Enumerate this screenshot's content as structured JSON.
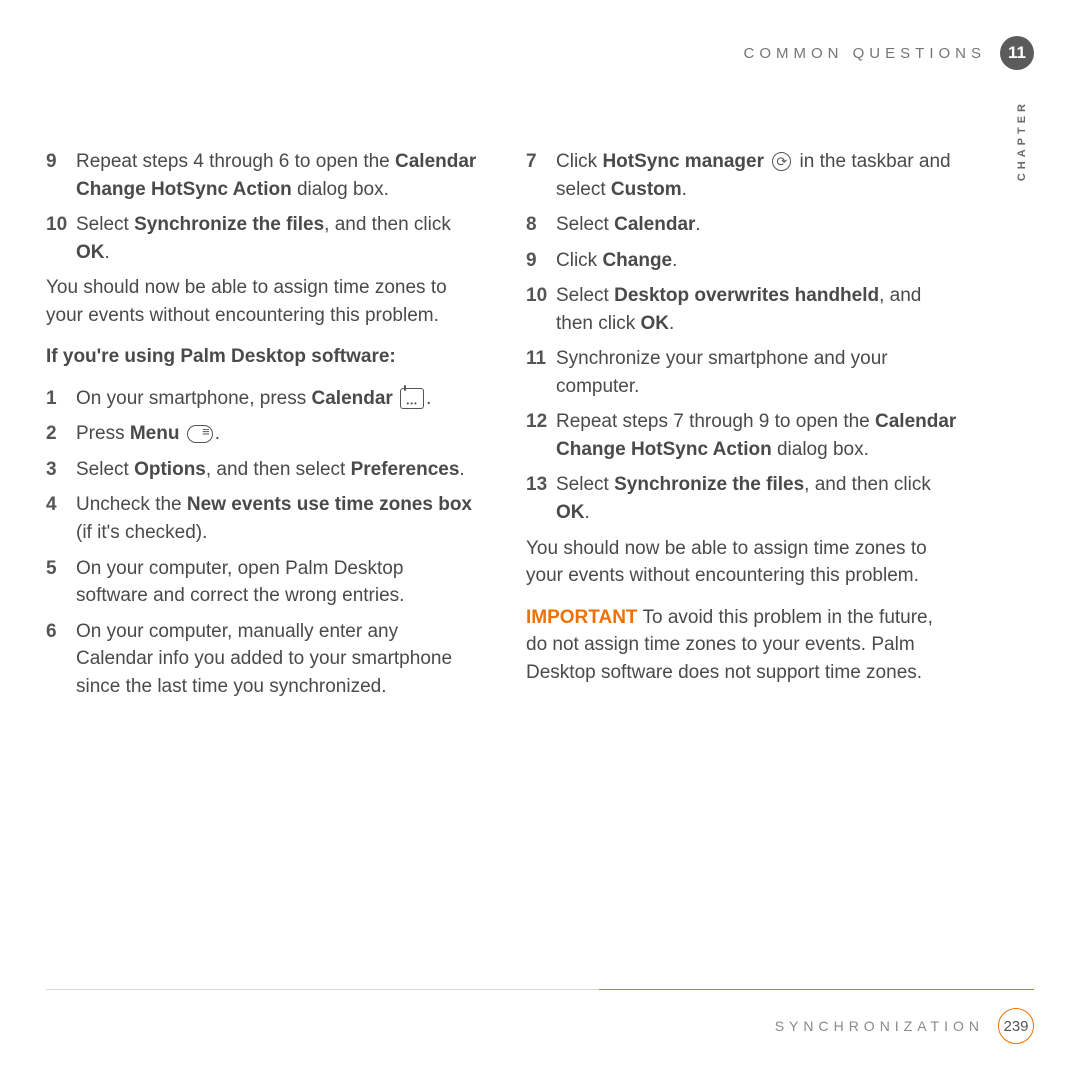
{
  "header": {
    "title": "COMMON QUESTIONS",
    "chapter_number": "11",
    "side_label": "CHAPTER"
  },
  "left": {
    "s9_a": "Repeat steps 4 through 6 to open the ",
    "s9_b": "Calendar Change HotSync Action",
    "s9_c": " dialog box.",
    "s10_a": "Select ",
    "s10_b": "Synchronize the files",
    "s10_c": ", and then click ",
    "s10_d": "OK",
    "s10_e": ".",
    "para1": "You should now be able to assign time zones to your events without encountering this problem.",
    "subhead": "If you're using Palm Desktop software:",
    "s1_a": "On your smartphone, press ",
    "s1_b": "Calendar",
    "s1_c": ".",
    "s2_a": "Press ",
    "s2_b": "Menu",
    "s2_c": ".",
    "s3_a": "Select ",
    "s3_b": "Options",
    "s3_c": ", and then select ",
    "s3_d": "Preferences",
    "s3_e": ".",
    "s4_a": "Uncheck the ",
    "s4_b": "New events use time zones box",
    "s4_c": " (if it's checked).",
    "s5": "On your computer, open Palm Desktop software and correct the wrong entries.",
    "s6": "On your computer, manually enter any Calendar info you added to your smartphone since the last time you synchronized."
  },
  "right": {
    "s7_a": "Click ",
    "s7_b": "HotSync manager",
    "s7_c": " in the taskbar and select ",
    "s7_d": "Custom",
    "s7_e": ".",
    "s8_a": "Select ",
    "s8_b": "Calendar",
    "s8_c": ".",
    "s9_a": "Click ",
    "s9_b": "Change",
    "s9_c": ".",
    "s10_a": "Select ",
    "s10_b": "Desktop overwrites handheld",
    "s10_c": ", and then click ",
    "s10_d": "OK",
    "s10_e": ".",
    "s11": "Synchronize your smartphone and your computer.",
    "s12_a": "Repeat steps 7 through 9 to open the ",
    "s12_b": "Calendar Change HotSync Action",
    "s12_c": " dialog box.",
    "s13_a": "Select ",
    "s13_b": "Synchronize the files",
    "s13_c": ", and then click ",
    "s13_d": "OK",
    "s13_e": ".",
    "para2": "You should now be able to assign time zones to your events without encountering this problem.",
    "imp_label": "IMPORTANT",
    "imp_text": " To avoid this problem in the future, do not assign time zones to your events. Palm Desktop software does not support time zones."
  },
  "nums": {
    "n1": "1",
    "n2": "2",
    "n3": "3",
    "n4": "4",
    "n5": "5",
    "n6": "6",
    "n7": "7",
    "n8": "8",
    "n9": "9",
    "n10": "10",
    "n11": "11",
    "n12": "12",
    "n13": "13"
  },
  "footer": {
    "title": "SYNCHRONIZATION",
    "page": "239"
  }
}
